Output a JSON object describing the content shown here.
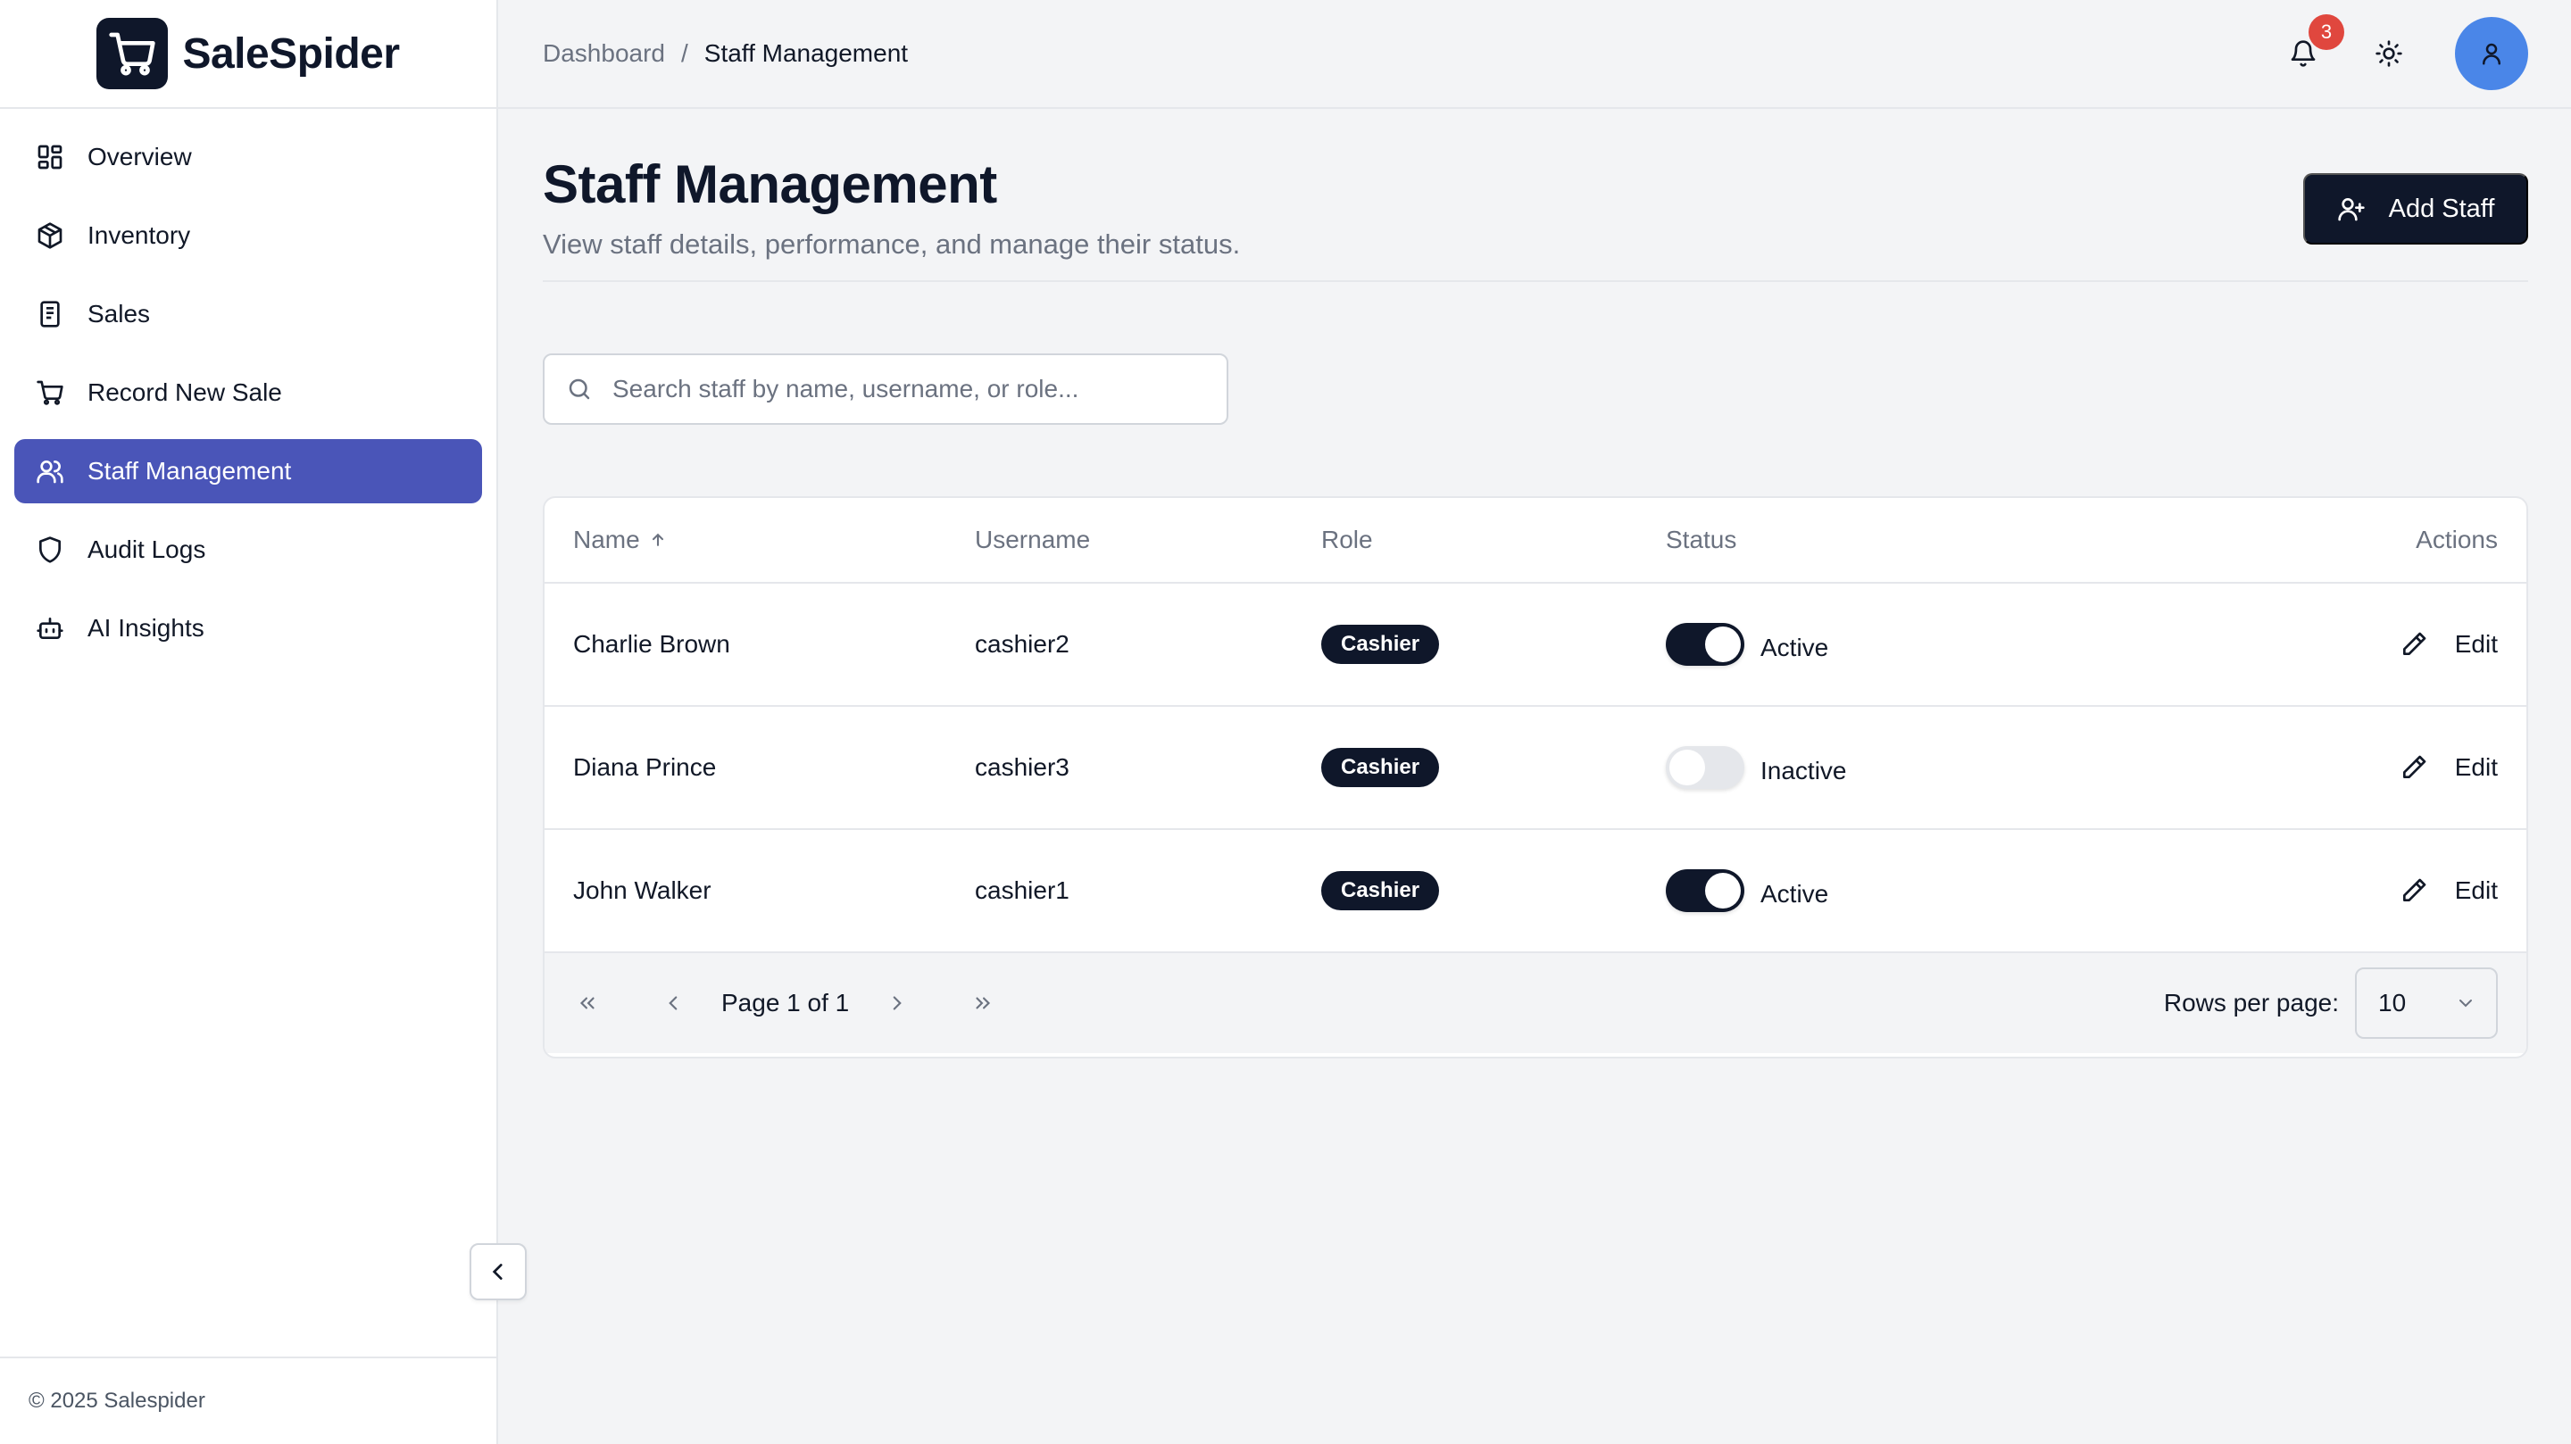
{
  "app": {
    "name": "SaleSpider",
    "footer": "© 2025 Salespider"
  },
  "sidebar": {
    "items": [
      {
        "label": "Overview",
        "icon": "grid-icon",
        "active": false
      },
      {
        "label": "Inventory",
        "icon": "package-icon",
        "active": false
      },
      {
        "label": "Sales",
        "icon": "receipt-icon",
        "active": false
      },
      {
        "label": "Record New Sale",
        "icon": "cart-icon",
        "active": false
      },
      {
        "label": "Staff Management",
        "icon": "users-icon",
        "active": true
      },
      {
        "label": "Audit Logs",
        "icon": "shield-icon",
        "active": false
      },
      {
        "label": "AI Insights",
        "icon": "bot-icon",
        "active": false
      }
    ]
  },
  "header": {
    "breadcrumb": [
      "Dashboard",
      "Staff Management"
    ],
    "notification_count": "3"
  },
  "page": {
    "title": "Staff Management",
    "subtitle": "View staff details, performance, and manage their status.",
    "add_button": "Add Staff",
    "search_placeholder": "Search staff by name, username, or role..."
  },
  "table": {
    "columns": [
      "Name",
      "Username",
      "Role",
      "Status",
      "Actions"
    ],
    "rows": [
      {
        "name": "Charlie Brown",
        "username": "cashier2",
        "role": "Cashier",
        "active": true,
        "status": "Active",
        "action": "Edit"
      },
      {
        "name": "Diana Prince",
        "username": "cashier3",
        "role": "Cashier",
        "active": false,
        "status": "Inactive",
        "action": "Edit"
      },
      {
        "name": "John Walker",
        "username": "cashier1",
        "role": "Cashier",
        "active": true,
        "status": "Active",
        "action": "Edit"
      }
    ],
    "pagination": {
      "label": "Page 1 of 1",
      "rows_per_page_label": "Rows per page:",
      "rows_per_page": "10"
    }
  },
  "colors": {
    "accent": "#4a55b8",
    "primary": "#0f172a",
    "badge": "#e0473e",
    "avatar": "#4a86e8"
  }
}
